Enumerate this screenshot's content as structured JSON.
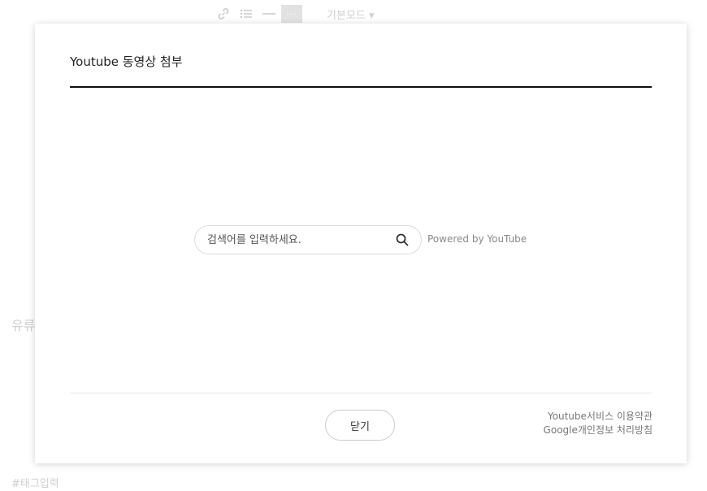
{
  "background": {
    "toolbar": {
      "link_icon": "link-icon",
      "list_icon": "bullet-list-icon",
      "divider_icon": "horizontal-rule-icon",
      "more_label": "···",
      "mode_label": "기본모드 ▾"
    },
    "left_text": "유류",
    "tag_input": "#태그입력"
  },
  "modal": {
    "title": "Youtube 동영상 첨부",
    "search": {
      "placeholder": "검색어를 입력하세요.",
      "value": "",
      "icon": "search-icon"
    },
    "powered_by": "Powered by YouTube",
    "close_label": "닫기",
    "terms": {
      "youtube_terms": "Youtube서비스 이용약관",
      "google_privacy": "Google개인정보 처리방침"
    }
  }
}
